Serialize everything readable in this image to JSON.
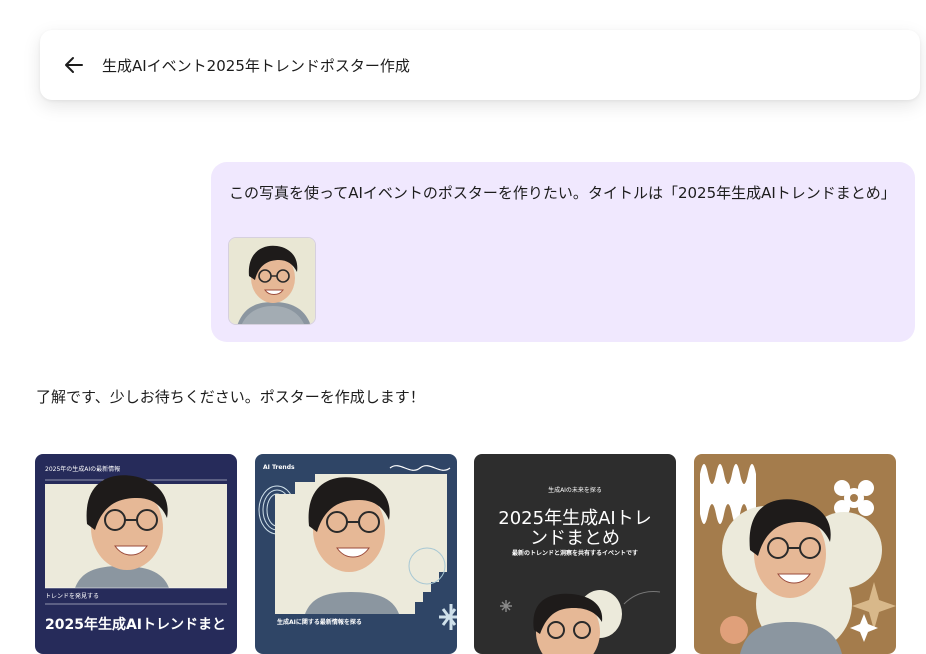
{
  "header": {
    "back_icon": "arrow-left-icon",
    "title": "生成AIイベント2025年トレンドポスター作成"
  },
  "user_message": {
    "text": "この写真を使ってAIイベントのポスターを作りたい。タイトルは「2025年生成AIトレンドまとめ」",
    "attachment": "portrait-photo"
  },
  "assistant_message": {
    "text": "了解です、少しお待ちください。ポスターを作成します！"
  },
  "posters": [
    {
      "top_label": "2025年の生成AIの最新情報",
      "mid_label": "トレンドを発見する",
      "title": "2025年生成AIトレンドまと",
      "bg": "#262b5a"
    },
    {
      "top_label": "AI Trends",
      "bottom_label": "生成AIに関する最新情報を探る",
      "bg": "#2f4566"
    },
    {
      "top_label": "生成AIの未来を探る",
      "title_line1": "2025年生成AIトレ",
      "title_line2": "ンドまとめ",
      "subtitle": "最新のトレンドと洞察を共有するイベントです",
      "bg": "#2d2d2d"
    },
    {
      "bg": "#a47c4c"
    }
  ]
}
